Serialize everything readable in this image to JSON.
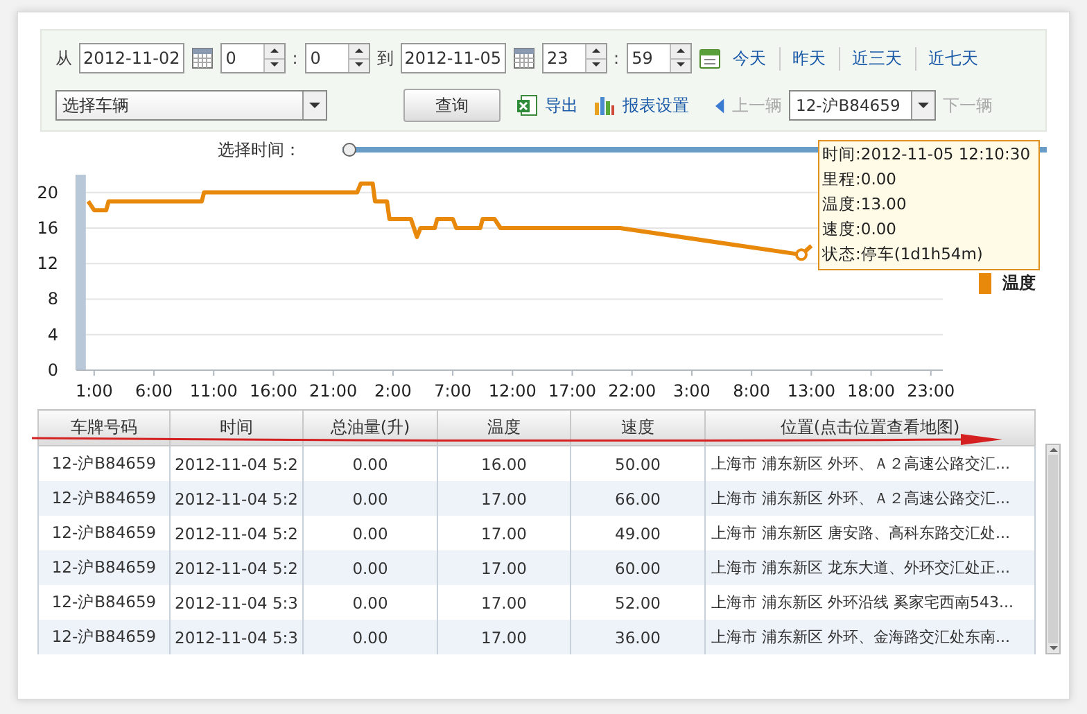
{
  "filter": {
    "from_label": "从",
    "start_date": "2012-11-02",
    "start_time": {
      "hour": "0",
      "sep": ":",
      "minute": "0"
    },
    "to_label": "到",
    "end_date": "2012-11-05",
    "end_time": {
      "hour": "23",
      "sep": ":",
      "minute": "59"
    },
    "quick_links": [
      "今天",
      "昨天",
      "近三天",
      "近七天"
    ],
    "vehicle_select": {
      "placeholder": "选择车辆"
    },
    "query_button": "查询",
    "export_link": "导出",
    "report_settings_link": "报表设置",
    "prev_vehicle": {
      "label": "上一辆",
      "disabled": true
    },
    "current_vehicle": "12-沪B84659",
    "next_vehicle": {
      "label": "下一辆",
      "disabled": true
    }
  },
  "time_slider": {
    "label": "选择时间：",
    "level": 0
  },
  "chart": {
    "chart_data": {
      "type": "line",
      "grid": true,
      "bands": [
        {
          "axis": "x",
          "from": "2012-11-02 23:30",
          "to": "2012-11-03 00:18",
          "color": "#b8c8d8"
        }
      ],
      "xlim": [
        "2012-11-02 23:30",
        "2012-11-06 00:00"
      ],
      "ylim": [
        0,
        22
      ],
      "yticks": [
        0,
        4,
        8,
        12,
        16,
        20
      ],
      "xticks": [
        {
          "value": "2012-11-03 01:00",
          "label": "1:00"
        },
        {
          "value": "2012-11-03 06:00",
          "label": "6:00"
        },
        {
          "value": "2012-11-03 11:00",
          "label": "11:00"
        },
        {
          "value": "2012-11-03 16:00",
          "label": "16:00"
        },
        {
          "value": "2012-11-03 21:00",
          "label": "21:00"
        },
        {
          "value": "2012-11-04 02:00",
          "label": "2:00"
        },
        {
          "value": "2012-11-04 07:00",
          "label": "7:00"
        },
        {
          "value": "2012-11-04 12:00",
          "label": "12:00"
        },
        {
          "value": "2012-11-04 17:00",
          "label": "17:00"
        },
        {
          "value": "2012-11-04 22:00",
          "label": "22:00"
        },
        {
          "value": "2012-11-05 03:00",
          "label": "3:00"
        },
        {
          "value": "2012-11-05 08:00",
          "label": "8:00"
        },
        {
          "value": "2012-11-05 13:00",
          "label": "13:00"
        },
        {
          "value": "2012-11-05 18:00",
          "label": "18:00"
        },
        {
          "value": "2012-11-05 23:00",
          "label": "23:00"
        }
      ],
      "x": [
        "2012-11-03 00:30",
        "2012-11-03 01:00",
        "2012-11-03 02:00",
        "2012-11-03 02:12",
        "2012-11-03 10:00",
        "2012-11-03 10:12",
        "2012-11-03 23:00",
        "2012-11-03 23:18",
        "2012-11-04 00:18",
        "2012-11-04 00:30",
        "2012-11-04 01:30",
        "2012-11-04 01:42",
        "2012-11-04 03:30",
        "2012-11-04 04:00",
        "2012-11-04 04:18",
        "2012-11-04 05:30",
        "2012-11-04 05:42",
        "2012-11-04 07:00",
        "2012-11-04 07:18",
        "2012-11-04 09:18",
        "2012-11-04 09:30",
        "2012-11-04 10:30",
        "2012-11-04 11:00",
        "2012-11-04 21:00",
        "2012-11-05 12:10",
        "2012-11-05 13:00"
      ],
      "series": [
        {
          "name": "温度",
          "color": "#e8890c",
          "values": [
            19,
            18,
            18,
            19,
            19,
            20,
            20,
            21,
            21,
            19,
            19,
            17,
            17,
            15,
            16,
            16,
            17,
            17,
            16,
            16,
            17,
            17,
            16,
            16,
            13,
            14
          ]
        }
      ]
    },
    "tooltip": [
      "时间:2012-11-05 12:10:30",
      "里程:0.00",
      "温度:13.00",
      "速度:0.00",
      "状态:停车(1d1h54m)"
    ]
  },
  "table": {
    "columns": [
      "车牌号码",
      "时间",
      "总油量(升)",
      "温度",
      "速度",
      "位置(点击位置查看地图)"
    ],
    "rows": [
      [
        "12-沪B84659",
        "2012-11-04 5:2",
        "0.00",
        "16.00",
        "50.00",
        "上海市 浦东新区 外环、Ａ２高速公路交汇..."
      ],
      [
        "12-沪B84659",
        "2012-11-04 5:2",
        "0.00",
        "17.00",
        "66.00",
        "上海市 浦东新区 外环、Ａ２高速公路交汇..."
      ],
      [
        "12-沪B84659",
        "2012-11-04 5:2",
        "0.00",
        "17.00",
        "49.00",
        "上海市 浦东新区 唐安路、高科东路交汇处..."
      ],
      [
        "12-沪B84659",
        "2012-11-04 5:2",
        "0.00",
        "17.00",
        "60.00",
        "上海市 浦东新区 龙东大道、外环交汇处正..."
      ],
      [
        "12-沪B84659",
        "2012-11-04 5:3",
        "0.00",
        "17.00",
        "52.00",
        "上海市 浦东新区 外环沿线 奚家宅西南543..."
      ],
      [
        "12-沪B84659",
        "2012-11-04 5:3",
        "0.00",
        "17.00",
        "36.00",
        "上海市 浦东新区 外环、金海路交汇处东南..."
      ]
    ]
  }
}
